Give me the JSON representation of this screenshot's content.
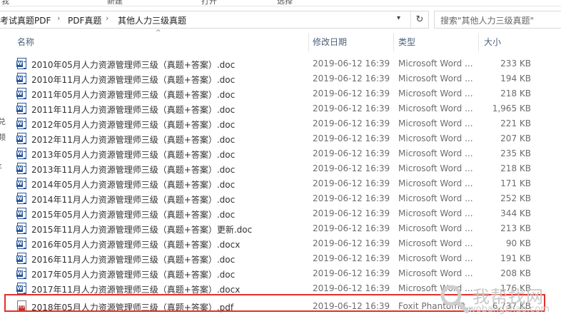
{
  "ribbon": {
    "tabs": [
      "我",
      "新建",
      "打开",
      "选择"
    ]
  },
  "address": {
    "crumbs": [
      "考试真题PDF",
      "PDF真题",
      "其他人力三级真题"
    ]
  },
  "search": {
    "placeholder": "搜索\"其他人力三级真题\""
  },
  "nav_fragments": [
    "兑",
    "频",
    "ɛ"
  ],
  "columns": {
    "name": "名称",
    "date": "修改日期",
    "type": "类型",
    "size": "大小"
  },
  "files": [
    {
      "name": "2010年05月人力资源管理师三级（真题+答案）.doc",
      "date": "2019-06-12 16:39",
      "type": "Microsoft Word ...",
      "size": "233 KB",
      "icon": "word-doc-icon"
    },
    {
      "name": "2010年11月人力资源管理师三级（真题+答案）.doc",
      "date": "2019-06-12 16:39",
      "type": "Microsoft Word ...",
      "size": "194 KB",
      "icon": "word-doc-icon"
    },
    {
      "name": "2011年05月人力资源管理师三级（真题+答案）.doc",
      "date": "2019-06-12 16:39",
      "type": "Microsoft Word ...",
      "size": "218 KB",
      "icon": "word-doc-icon"
    },
    {
      "name": "2011年11月人力资源管理师三级（真题+答案）.doc",
      "date": "2019-06-12 16:39",
      "type": "Microsoft Word ...",
      "size": "1,965 KB",
      "icon": "word-doc-icon"
    },
    {
      "name": "2012年05月人力资源管理师三级（真题+答案）.doc",
      "date": "2019-06-12 16:39",
      "type": "Microsoft Word ...",
      "size": "221 KB",
      "icon": "word-doc-icon"
    },
    {
      "name": "2012年11月人力资源管理师三级（真题+答案）.doc",
      "date": "2019-06-12 16:39",
      "type": "Microsoft Word ...",
      "size": "207 KB",
      "icon": "word-doc-icon"
    },
    {
      "name": "2013年05月人力资源管理师三级（真题+答案）.doc",
      "date": "2019-06-12 16:39",
      "type": "Microsoft Word ...",
      "size": "235 KB",
      "icon": "word-doc-icon"
    },
    {
      "name": "2013年11月人力资源管理师三级（真题+答案）.doc",
      "date": "2019-06-12 16:39",
      "type": "Microsoft Word ...",
      "size": "218 KB",
      "icon": "word-doc-icon"
    },
    {
      "name": "2014年05月人力资源管理师三级（真题+答案）.doc",
      "date": "2019-06-12 16:39",
      "type": "Microsoft Word ...",
      "size": "171 KB",
      "icon": "word-doc-icon"
    },
    {
      "name": "2014年11月人力资源管理师三级（真题+答案）.doc",
      "date": "2019-06-12 16:39",
      "type": "Microsoft Word ...",
      "size": "252 KB",
      "icon": "word-doc-icon"
    },
    {
      "name": "2015年05月人力资源管理师三级（真题+答案）.doc",
      "date": "2019-06-12 16:39",
      "type": "Microsoft Word ...",
      "size": "344 KB",
      "icon": "word-doc-icon"
    },
    {
      "name": "2015年11月人力资源管理师三级（真题+答案）更新.doc",
      "date": "2019-06-12 16:39",
      "type": "Microsoft Word ...",
      "size": "213 KB",
      "icon": "word-doc-icon"
    },
    {
      "name": "2016年05月人力资源管理师三级（真题+答案）.docx",
      "date": "2019-06-12 16:39",
      "type": "Microsoft Word ...",
      "size": "90 KB",
      "icon": "word-docx-icon"
    },
    {
      "name": "2016年11月人力资源管理师三级（真题+答案）.doc",
      "date": "2019-06-12 16:39",
      "type": "Microsoft Word ...",
      "size": "191 KB",
      "icon": "word-doc-icon"
    },
    {
      "name": "2017年05月人力资源管理师三级（真题+答案）.doc",
      "date": "2019-06-12 16:39",
      "type": "Microsoft Word ...",
      "size": "208 KB",
      "icon": "word-doc-icon"
    },
    {
      "name": "2017年11月人力资源管理师三级（真题+答案）.docx",
      "date": "2019-06-12 16:39",
      "type": "Microsoft Word ...",
      "size": "176 KB",
      "icon": "word-docx-icon"
    },
    {
      "name": "2018年05月人力资源管理师三级（真题+答案）.pdf",
      "date": "2019-06-12 16:39",
      "type": "Foxit PhantomP...",
      "size": "6,737 KB",
      "icon": "pdf-icon"
    }
  ],
  "colors": {
    "highlight_border": "#e0302b",
    "word_blue": "#2b579a",
    "header_text": "#4c607a"
  },
  "watermark": {
    "text": "我帮找网",
    "url": "wobangzhao.com"
  }
}
